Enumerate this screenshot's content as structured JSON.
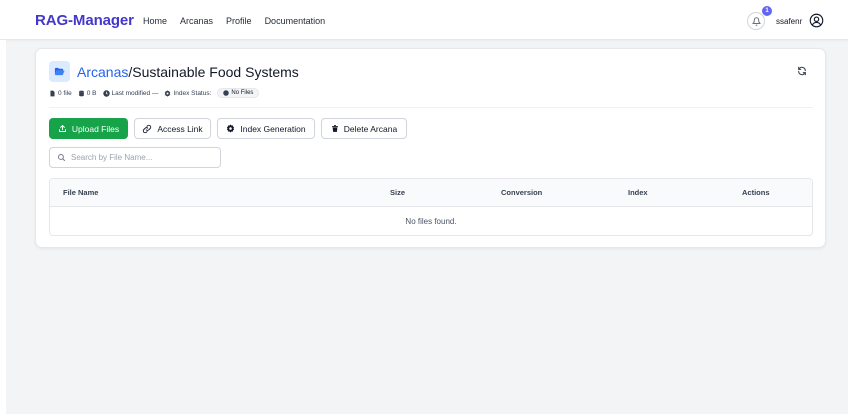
{
  "navbar": {
    "brand": "RAG-Manager",
    "links": [
      "Home",
      "Arcanas",
      "Profile",
      "Documentation"
    ],
    "notification_count": "1",
    "username": "ssafenr"
  },
  "header": {
    "breadcrumb_parent": "Arcanas",
    "breadcrumb_separator": "/",
    "breadcrumb_current": "Sustainable Food Systems"
  },
  "meta": {
    "file_count": "0 file",
    "size": "0 B",
    "last_modified": "Last modified —",
    "index_status_label": "Index Status:",
    "index_status_value": "No Files"
  },
  "actions": {
    "upload": "Upload Files",
    "access_link": "Access Link",
    "index_generation": "Index Generation",
    "delete": "Delete Arcana"
  },
  "search": {
    "placeholder": "Search by File Name..."
  },
  "table": {
    "columns": [
      "File Name",
      "Size",
      "Conversion",
      "Index",
      "Actions"
    ],
    "empty_message": "No files found."
  },
  "icons": [
    "bell-icon",
    "user-circle-icon",
    "folder-open-icon",
    "refresh-icon",
    "file-icon",
    "database-icon",
    "clock-icon",
    "gear-icon",
    "status-dot-icon",
    "upload-icon",
    "link-icon",
    "delete-icon",
    "search-icon"
  ],
  "colors": {
    "brand": "#4338ca",
    "primary_button": "#16a34a",
    "link": "#2563eb",
    "badge": "#6366f1"
  }
}
